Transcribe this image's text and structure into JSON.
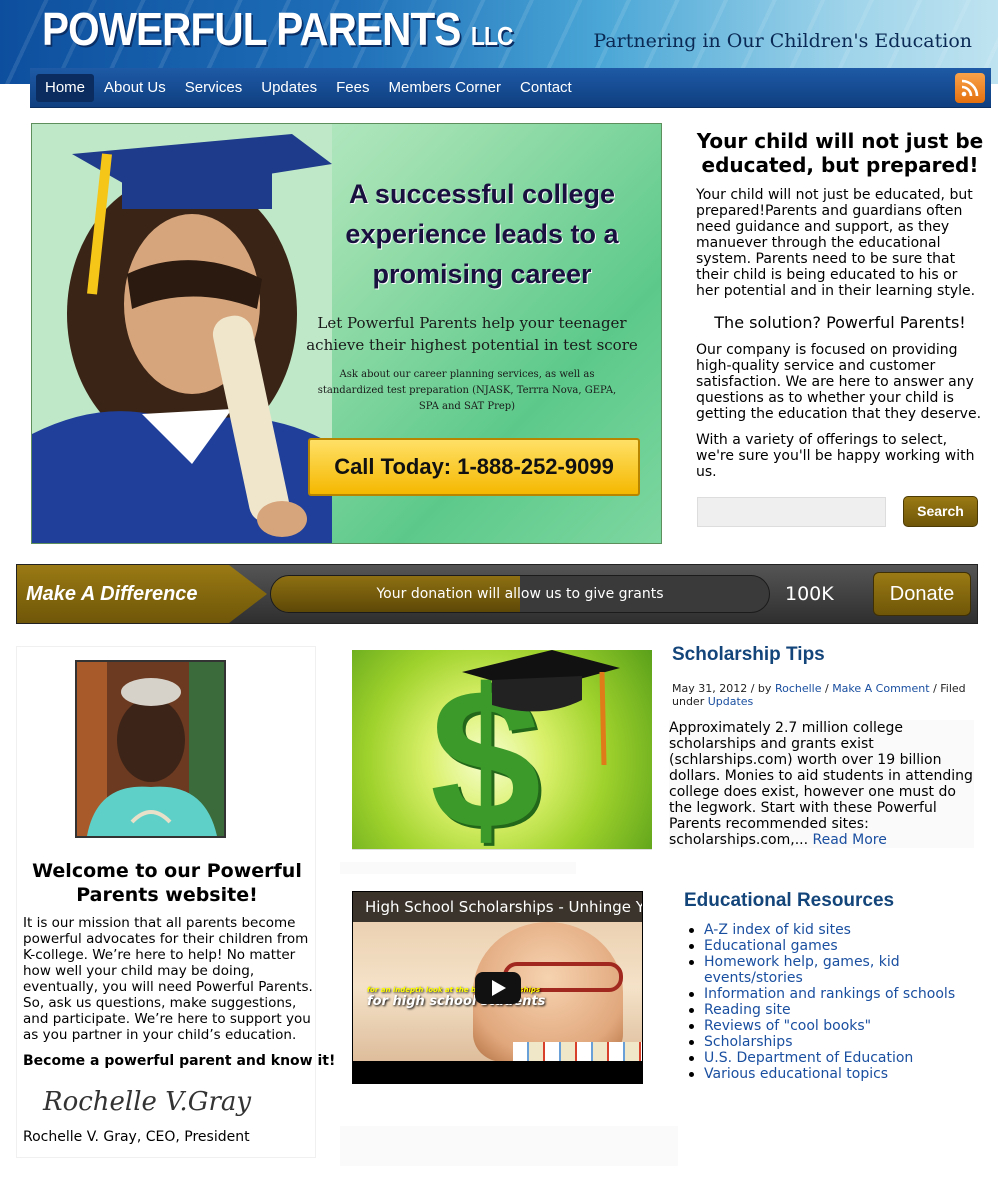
{
  "header": {
    "logo": "POWERFUL PARENTS",
    "logo_suffix": "LLC",
    "tagline": "Partnering in Our Children's Education"
  },
  "nav": {
    "items": [
      "Home",
      "About Us",
      "Services",
      "Updates",
      "Fees",
      "Members Corner",
      "Contact"
    ],
    "active": "Home",
    "rss_icon": "rss-icon"
  },
  "hero": {
    "headline": "A successful college experience leads to a promising career",
    "subhead": "Let Powerful Parents help your teenager achieve their highest potential in test score",
    "small": "Ask about our career planning services, as well as standardized test preparation (NJASK, Terrra Nova, GEPA, SPA and SAT Prep)",
    "call": "Call Today:  1-888-252-9099"
  },
  "intro": {
    "title": "Your child will not just be educated, but prepared!",
    "p1": "Your child will not just be educated, but prepared!Parents and guardians often need guidance and support, as they manuever through the educational system. Parents need to be sure that their child is being educated to his or her potential and in their learning style.",
    "solution": "The solution? Powerful Parents!",
    "p2": "Our company is focused on providing high-quality service and customer satisfaction. We are here to answer any questions as to whether your child is getting the education that they deserve.",
    "p3": "With a variety of offerings to select, we're sure you'll be happy working with us."
  },
  "search": {
    "value": "",
    "button": "Search"
  },
  "donation": {
    "label": "Make A Difference",
    "progress_text": "Your donation will allow us to give grants",
    "progress_fraction": 0.5,
    "goal": "100K",
    "button": "Donate"
  },
  "welcome": {
    "title": "Welcome to our Powerful Parents website!",
    "body": "It is our mission that all parents become powerful advocates for their children from K-college. We’re here to help! No matter how well your child may be doing, eventually, you will need Powerful Parents. So, ask us questions, make suggestions, and participate. We’re here to support you as you partner in your child’s education.",
    "bold": "Become a powerful parent and know it!",
    "signature": "Rochelle V.Gray",
    "ceo": "Rochelle V. Gray, CEO, President"
  },
  "post": {
    "title": "Scholarship Tips",
    "date": "May 31, 2012",
    "by": " / by ",
    "author": "Rochelle",
    "sep": " / ",
    "comment": "Make A Comment",
    "filed": " / Filed under ",
    "category": "Updates",
    "body": "Approximately 2.7 million college scholarships and grants exist (schlarships.com) worth over 19 billion dollars. Monies to aid students in attending college does exist, however one must do the legwork.  Start with these Powerful Parents recommended sites: scholarships.com,... ",
    "read_more": "Read More"
  },
  "video": {
    "title": "High School Scholarships - Unhinge Y",
    "caption_small": "for an indepth look at the best scholarships",
    "caption": "for high school students"
  },
  "resources": {
    "title": "Educational Resources",
    "items": [
      "A-Z index of kid sites",
      "Educational games",
      "Homework help, games, kid events/stories",
      "Information and rankings of schools",
      "Reading site",
      "Reviews of \"cool books\"",
      "Scholarships",
      "U.S. Department of Education",
      "Various educational topics"
    ]
  }
}
